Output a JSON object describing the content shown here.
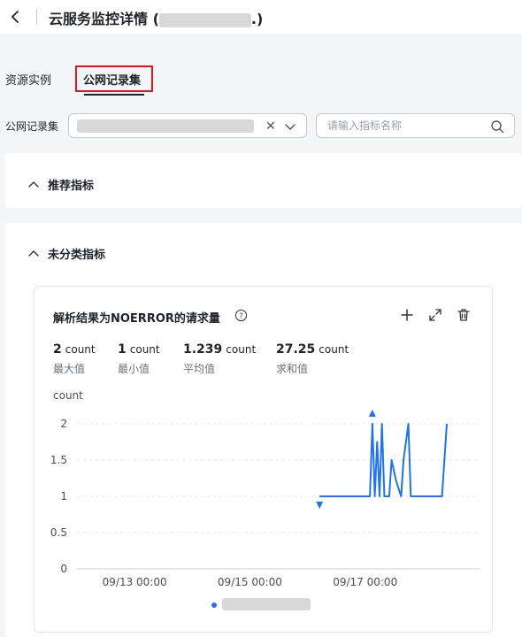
{
  "header": {
    "title_prefix": "云服务监控详情 (",
    "title_suffix": ".)"
  },
  "tabs": [
    {
      "label": "资源实例",
      "selected": false
    },
    {
      "label": "公网记录集",
      "selected": true
    }
  ],
  "filter": {
    "label": "公网记录集",
    "search_placeholder": "请输入指标名称"
  },
  "sections": {
    "recommended": "推荐指标",
    "uncategorized": "未分类指标"
  },
  "card": {
    "title": "解析结果为NOERROR的请求量",
    "stats": [
      {
        "value": "2",
        "unit": "count",
        "label": "最大值"
      },
      {
        "value": "1",
        "unit": "count",
        "label": "最小值"
      },
      {
        "value": "1.239",
        "unit": "count",
        "label": "平均值"
      },
      {
        "value": "27.25",
        "unit": "count",
        "label": "求和值"
      }
    ]
  },
  "colors": {
    "accent": "#1f74ec",
    "highlight_border": "#e5141b"
  },
  "chart_data": {
    "type": "line",
    "ylabel": "count",
    "ylim": [
      0,
      2
    ],
    "yticks": [
      "0",
      "0.5",
      "1",
      "1.5",
      "2"
    ],
    "xticks": [
      "09/13 00:00",
      "09/15 00:00",
      "09/17 00:00"
    ],
    "xtick_hours": [
      48,
      96,
      144
    ],
    "xlim_hours": [
      24,
      192
    ],
    "grid": true,
    "series": [
      {
        "color": "#1f74ec",
        "points": [
          [
            125,
            1
          ],
          [
            146,
            1
          ],
          [
            147,
            2
          ],
          [
            148,
            1
          ],
          [
            149,
            1.75
          ],
          [
            150,
            1
          ],
          [
            151,
            2
          ],
          [
            152,
            1
          ],
          [
            154,
            1
          ],
          [
            155,
            1.5
          ],
          [
            157,
            1.2
          ],
          [
            159,
            1
          ],
          [
            160,
            1.5
          ],
          [
            162,
            2
          ],
          [
            163,
            1
          ],
          [
            176,
            1
          ],
          [
            178,
            2
          ]
        ],
        "max_marker": [
          147,
          2
        ],
        "min_marker": [
          125,
          1
        ]
      }
    ]
  }
}
